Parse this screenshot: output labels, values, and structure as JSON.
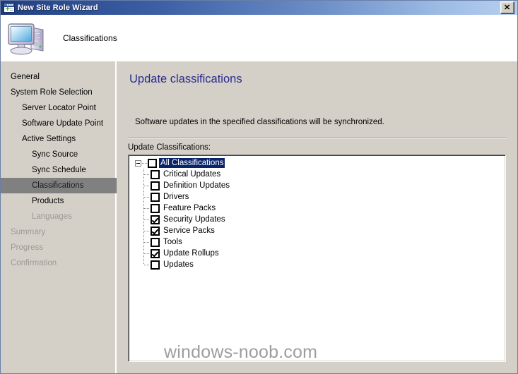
{
  "window": {
    "title": "New Site Role Wizard",
    "titlebar_icon": "new-window-icon",
    "close_label": "✕"
  },
  "header": {
    "icon": "computer-icon",
    "title": "Classifications"
  },
  "sidebar": {
    "items": [
      {
        "label": "General",
        "level": 0,
        "state": "normal"
      },
      {
        "label": "System Role Selection",
        "level": 0,
        "state": "normal"
      },
      {
        "label": "Server Locator Point",
        "level": 1,
        "state": "normal"
      },
      {
        "label": "Software Update Point",
        "level": 1,
        "state": "normal"
      },
      {
        "label": "Active Settings",
        "level": 1,
        "state": "normal"
      },
      {
        "label": "Sync Source",
        "level": 2,
        "state": "normal"
      },
      {
        "label": "Sync Schedule",
        "level": 2,
        "state": "normal"
      },
      {
        "label": "Classifications",
        "level": 2,
        "state": "selected"
      },
      {
        "label": "Products",
        "level": 2,
        "state": "normal"
      },
      {
        "label": "Languages",
        "level": 2,
        "state": "disabled"
      },
      {
        "label": "Summary",
        "level": 0,
        "state": "disabled"
      },
      {
        "label": "Progress",
        "level": 0,
        "state": "disabled"
      },
      {
        "label": "Confirmation",
        "level": 0,
        "state": "disabled"
      }
    ]
  },
  "main": {
    "heading": "Update classifications",
    "description": "Software updates in the specified classifications will be synchronized.",
    "list_label": "Update Classifications:",
    "tree": {
      "root": {
        "label": "All Classifications",
        "checked": false,
        "selected": true,
        "expanded": true
      },
      "children": [
        {
          "label": "Critical Updates",
          "checked": false
        },
        {
          "label": "Definition Updates",
          "checked": false
        },
        {
          "label": "Drivers",
          "checked": false
        },
        {
          "label": "Feature Packs",
          "checked": false
        },
        {
          "label": "Security Updates",
          "checked": true
        },
        {
          "label": "Service Packs",
          "checked": true
        },
        {
          "label": "Tools",
          "checked": false
        },
        {
          "label": "Update Rollups",
          "checked": true
        },
        {
          "label": "Updates",
          "checked": false
        }
      ]
    }
  },
  "watermark": {
    "text": "windows-noob.com"
  },
  "colors": {
    "titlebar_start": "#1f3a78",
    "titlebar_end": "#b6d0ef",
    "dialog_face": "#d4d0c8",
    "heading": "#2b2b8f",
    "selection": "#0a246a",
    "nav_selected": "#808080",
    "disabled_text": "#9a9a96",
    "watermark": "#9d9d9d"
  }
}
